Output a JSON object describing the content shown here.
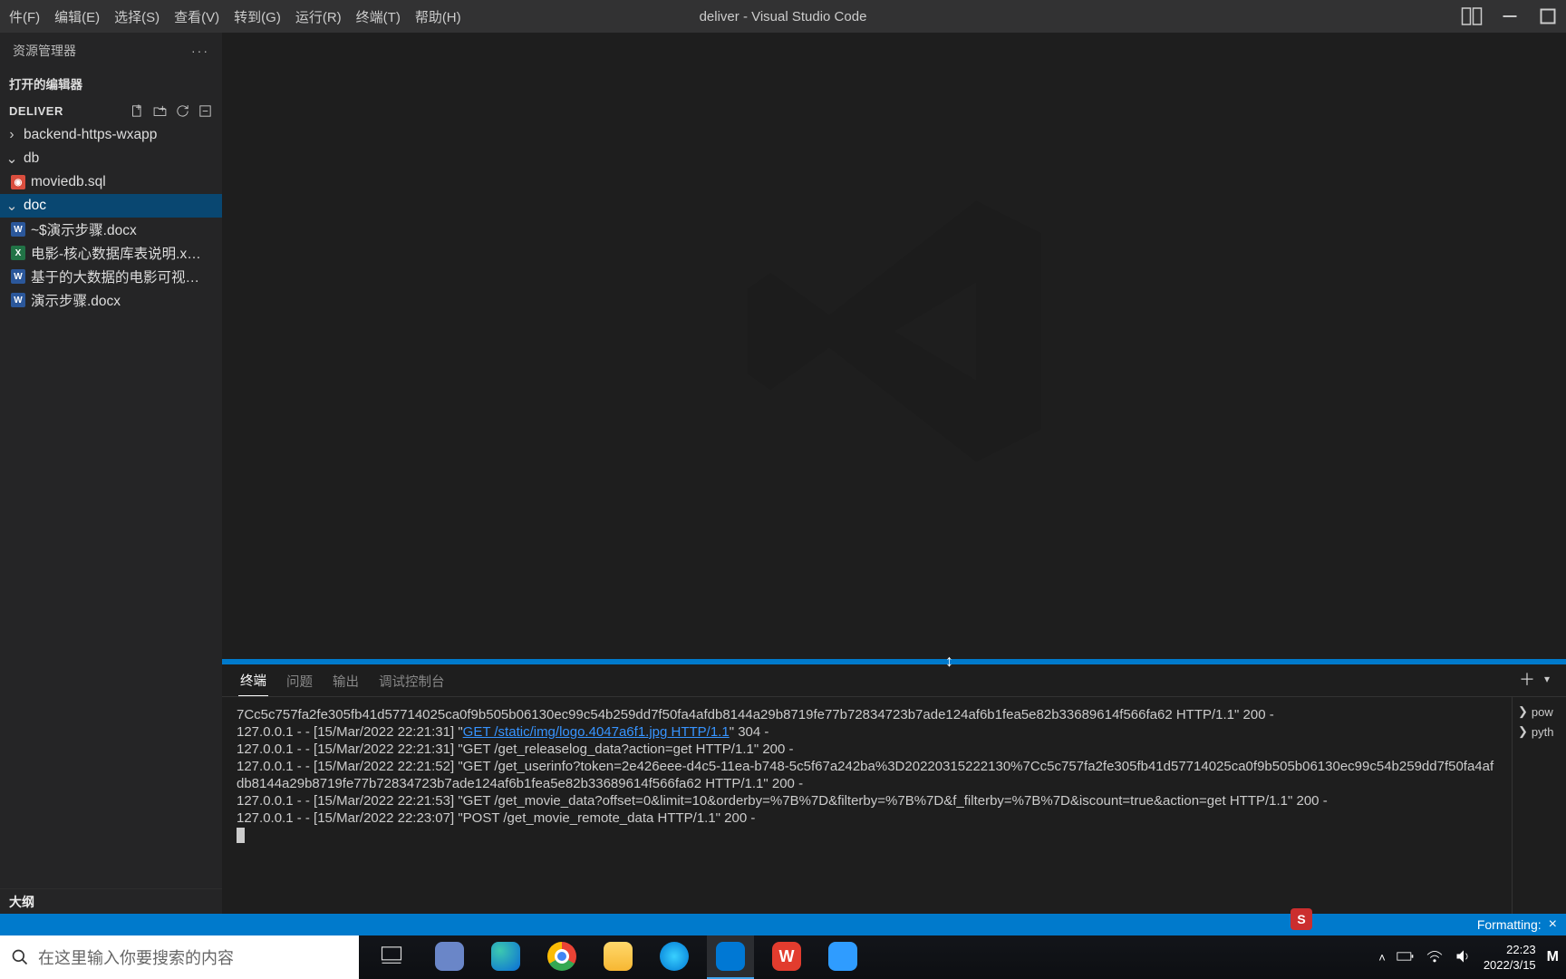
{
  "menubar": {
    "items": [
      "件(F)",
      "编辑(E)",
      "选择(S)",
      "查看(V)",
      "转到(G)",
      "运行(R)",
      "终端(T)",
      "帮助(H)"
    ]
  },
  "title": "deliver - Visual Studio Code",
  "explorer": {
    "header": "资源管理器",
    "open_editors": "打开的编辑器",
    "project": "DELIVER",
    "outline": "大纲",
    "tree": {
      "folder_backend": "backend-https-wxapp",
      "folder_db": "db",
      "file_sql": "moviedb.sql",
      "folder_doc": "doc",
      "file_doc1": "~$演示步骤.docx",
      "file_xlsx": "电影-核心数据库表说明.xlsx",
      "file_doc2": "基于的大数据的电影可视化...",
      "file_doc3": "演示步骤.docx"
    }
  },
  "panel": {
    "tabs": [
      "终端",
      "问题",
      "输出",
      "调试控制台"
    ],
    "side": [
      "pow",
      "pyth"
    ],
    "terminal": {
      "l0": "7Cc5c757fa2fe305fb41d57714025ca0f9b505b06130ec99c54b259dd7f50fa4afdb8144a29b8719fe77b72834723b7ade124af6b1fea5e82b33689614f566fa62 HTTP/1.1\" 200 -",
      "l1a": "127.0.0.1 - - [15/Mar/2022 22:21:31] \"",
      "l1b": "GET /static/img/logo.4047a6f1.jpg HTTP/1.1",
      "l1c": "\" 304 -",
      "l2": "127.0.0.1 - - [15/Mar/2022 22:21:31] \"GET /get_releaselog_data?action=get HTTP/1.1\" 200 -",
      "l3": "127.0.0.1 - - [15/Mar/2022 22:21:52] \"GET /get_userinfo?token=2e426eee-d4c5-11ea-b748-5c5f67a242ba%3D20220315222130%7Cc5c757fa2fe305fb41d57714025ca0f9b505b06130ec99c54b259dd7f50fa4afdb8144a29b8719fe77b72834723b7ade124af6b1fea5e82b33689614f566fa62 HTTP/1.1\" 200 -",
      "l4": "127.0.0.1 - - [15/Mar/2022 22:21:53] \"GET /get_movie_data?offset=0&limit=10&orderby=%7B%7D&filterby=%7B%7D&f_filterby=%7B%7D&iscount=true&action=get HTTP/1.1\" 200 -",
      "l5": "127.0.0.1 - - [15/Mar/2022 22:23:07] \"POST /get_movie_remote_data HTTP/1.1\" 200 -"
    }
  },
  "statusbar": {
    "text": "Formatting:"
  },
  "taskbar": {
    "search_placeholder": "在这里输入你要搜索的内容",
    "clock_time": "22:23",
    "clock_date": "2022/3/15"
  }
}
